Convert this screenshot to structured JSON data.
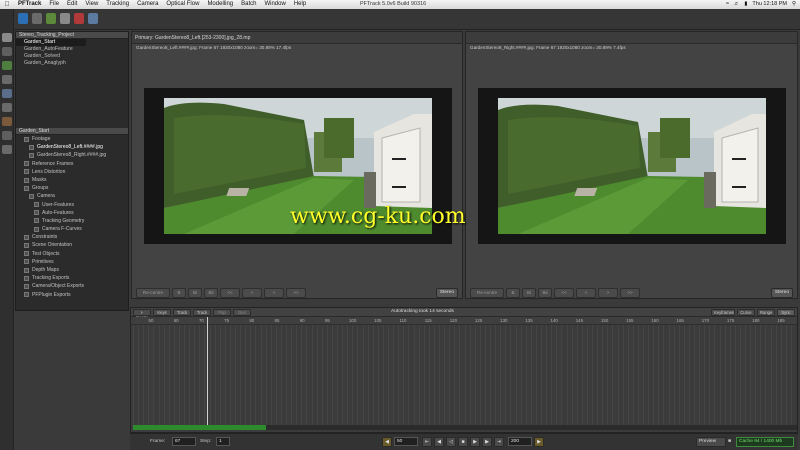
{
  "menubar": {
    "app_name": "PFTrack",
    "items": [
      "File",
      "Edit",
      "View",
      "Tracking",
      "Camera",
      "Optical Flow",
      "Modelling",
      "Batch",
      "Window",
      "Help"
    ],
    "window_title": "PFTrack 5.0v6 Build 90316",
    "clock": "Thu 12:18 PM"
  },
  "project_panel": {
    "header": "Stereo_Tracking_Project",
    "items": [
      "Garden_Start",
      "Garden_AutoFeature",
      "Garden_Solved",
      "Garden_Anaglyph"
    ],
    "selected_index": 0
  },
  "tree_panel": {
    "header": "Garden_Start",
    "items": [
      {
        "label": "Footage",
        "indent": 1
      },
      {
        "label": "GardenStereo8_Left.####.jpg",
        "indent": 2
      },
      {
        "label": "GardenStereo8_Right.####.jpg",
        "indent": 2
      },
      {
        "label": "Reference Frames",
        "indent": 1
      },
      {
        "label": "Lens Distortion",
        "indent": 1
      },
      {
        "label": "Masks",
        "indent": 1
      },
      {
        "label": "Groups",
        "indent": 1
      },
      {
        "label": "Camera",
        "indent": 2
      },
      {
        "label": "User-Features",
        "indent": 3
      },
      {
        "label": "Auto-Features",
        "indent": 3
      },
      {
        "label": "Tracking Geometry",
        "indent": 3
      },
      {
        "label": "Camera F-Curves",
        "indent": 3
      },
      {
        "label": "Constraints",
        "indent": 1
      },
      {
        "label": "Scene Orientation",
        "indent": 1
      },
      {
        "label": "Test Objects",
        "indent": 1
      },
      {
        "label": "Primitives",
        "indent": 1
      },
      {
        "label": "Depth Maps",
        "indent": 1
      },
      {
        "label": "Tracking Exports",
        "indent": 1
      },
      {
        "label": "Camera/Object Exports",
        "indent": 1
      },
      {
        "label": "PFPlugin Exports",
        "indent": 1
      }
    ]
  },
  "viewer_left": {
    "title": "Primary: GardenStereo8_Left.[253-2300].jpg_28.mp",
    "info": "GardenStereo8_Left.####.jpg: Frame 67  1920x1080  zoom= 30.89%  17.4fps",
    "buttons": [
      "Re-centre",
      "B",
      "Bi",
      "Bii",
      "<<",
      "<",
      ">",
      ">>"
    ],
    "stereo": "Stereo"
  },
  "viewer_right": {
    "info": "GardenStereo8_Right.####.jpg: Frame 67  1920x1080  zoom= 30.89%  7.4fps",
    "buttons": [
      "Re-centre",
      "B",
      "Bi",
      "Bii",
      "<<",
      "<",
      ">",
      ">>"
    ],
    "stereo": "Stereo"
  },
  "watermark": "www.cg-ku.com",
  "timeline": {
    "buttons_left": [
      "I-Centre",
      "Keys",
      "Track",
      "Track",
      "Pop",
      "Gen"
    ],
    "status": "Autotracking took 14 seconds",
    "buttons_right": [
      "Keyframes",
      "Curve",
      "Range",
      "Sync"
    ],
    "ticks": [
      "50",
      "60",
      "70",
      "75",
      "80",
      "85",
      "90",
      "95",
      "100",
      "105",
      "110",
      "115",
      "120",
      "125",
      "130",
      "135",
      "140",
      "145",
      "150",
      "155",
      "160",
      "165",
      "170",
      "175",
      "180",
      "185"
    ],
    "progress_fraction": 0.2
  },
  "status_bar": {
    "frame_label": "Frame:",
    "frame_value": "67",
    "step_label": "Step:",
    "step_value": "1",
    "start_value": "50",
    "end_value": "200",
    "preview": "Preview",
    "cache": "Cache 94 / 1400 Mb"
  },
  "colors": {
    "accent_green": "#2d8a2d",
    "watermark_yellow": "#ffff2a",
    "play_orange": "#c8a238"
  }
}
